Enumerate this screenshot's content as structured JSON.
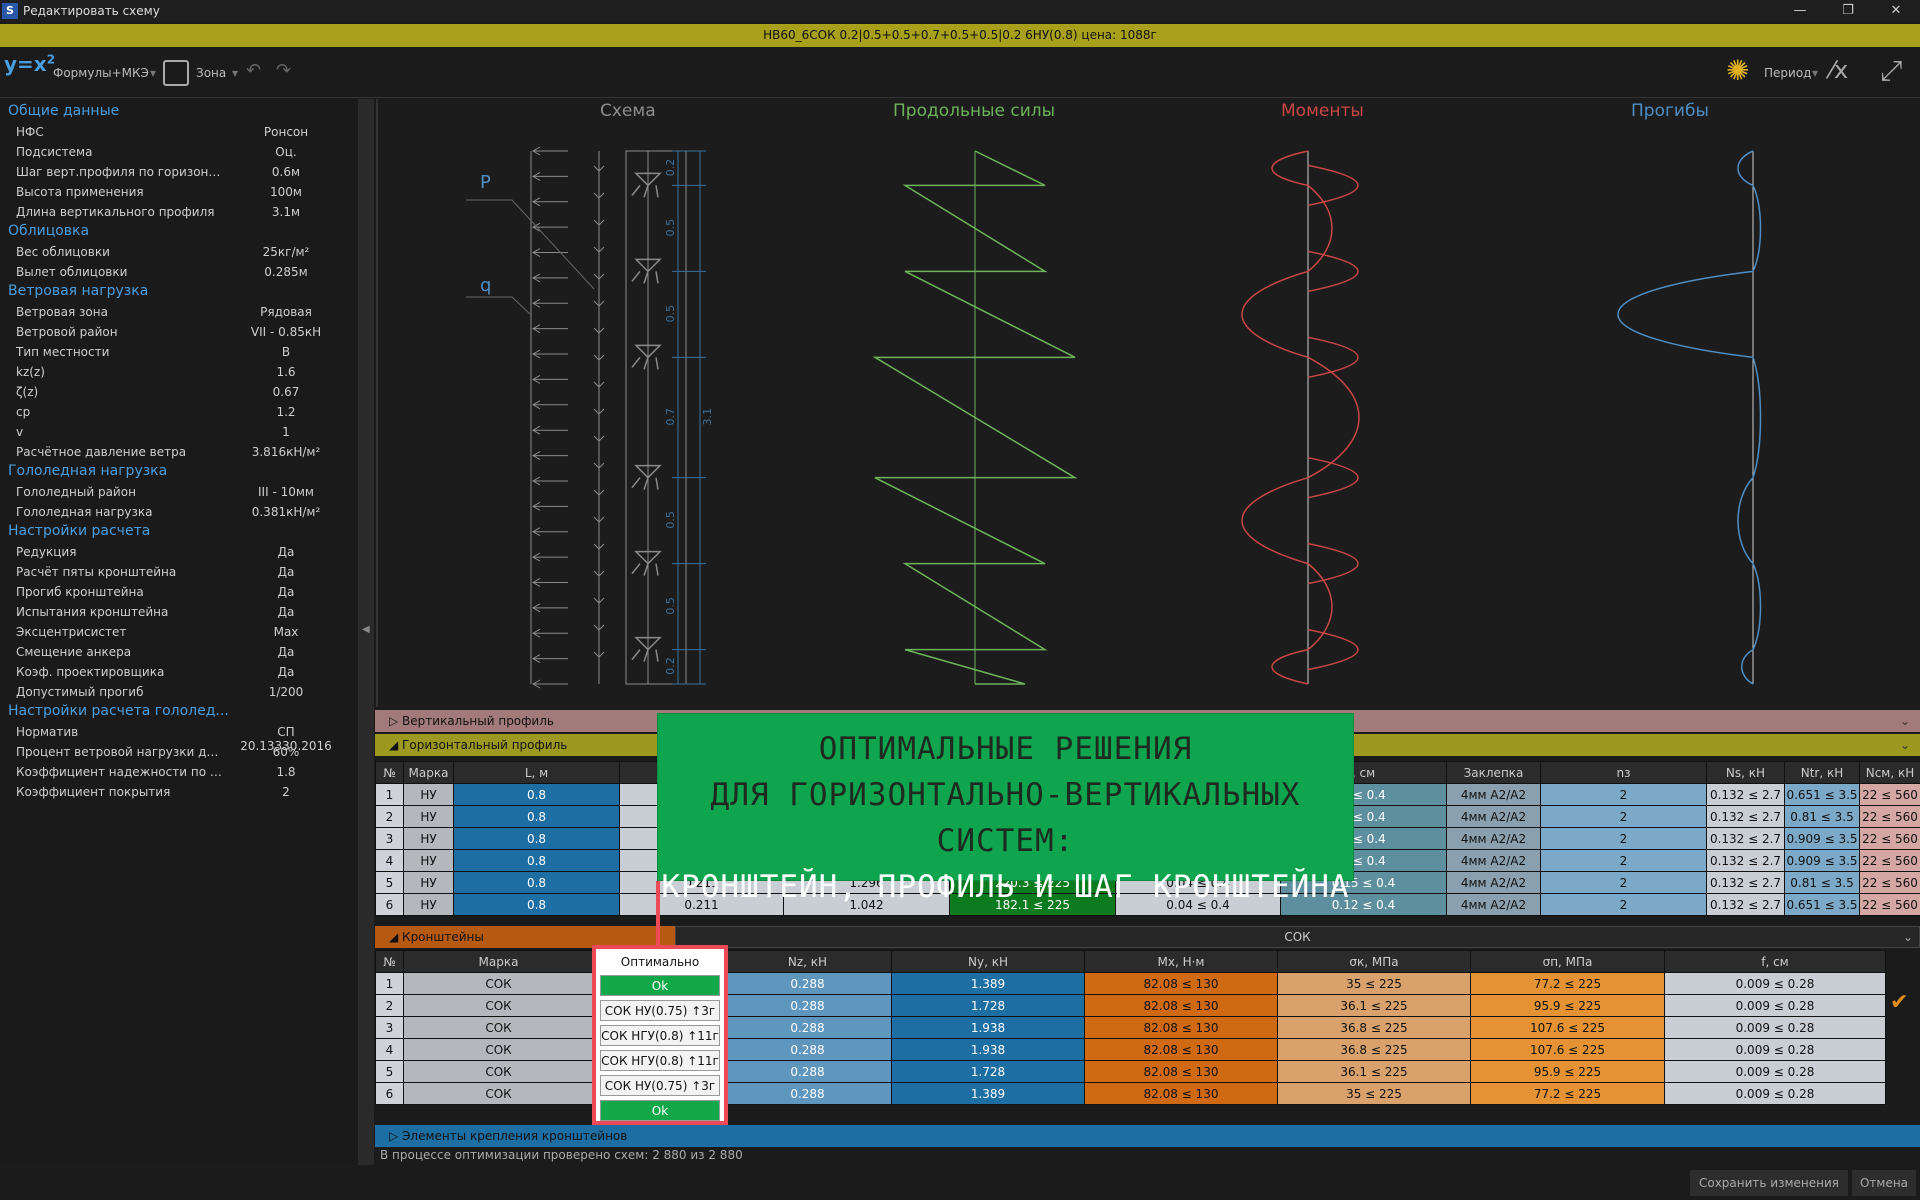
{
  "window": {
    "title": "Редактировать схему",
    "app_icon": "S"
  },
  "infobar": {
    "text": "НВ60_6СОК   0.2|0.5+0.5+0.7+0.5+0.5|0.2   6НУ(0.8)   цена: 1088г"
  },
  "toolbar": {
    "formula_label": "Формулы+МКЭ",
    "zone_label": "Зона",
    "period_label": "Период"
  },
  "left_panel": {
    "groups": [
      {
        "title": "Общие данные",
        "props": [
          [
            "НФС",
            "Ронсон"
          ],
          [
            "Подсистема",
            "Оц."
          ],
          [
            "Шаг верт.профиля по горизонта...",
            "0.6м"
          ],
          [
            "Высота применения",
            "100м"
          ],
          [
            "Длина вертикального профиля",
            "3.1м"
          ]
        ]
      },
      {
        "title": "Облицовка",
        "props": [
          [
            "Вес облицовки",
            "25кг/м²"
          ],
          [
            "Вылет облицовки",
            "0.285м"
          ]
        ]
      },
      {
        "title": "Ветровая нагрузка",
        "props": [
          [
            "Ветровая зона",
            "Рядовая"
          ],
          [
            "Ветровой район",
            "VII - 0.85кН"
          ],
          [
            "Тип местности",
            "B"
          ],
          [
            "kz(z)",
            "1.6"
          ],
          [
            "ζ(z)",
            "0.67"
          ],
          [
            "cp",
            "1.2"
          ],
          [
            "v",
            "1"
          ],
          [
            "Расчётное давление ветра",
            "3.816кН/м²"
          ]
        ]
      },
      {
        "title": "Гололедная нагрузка",
        "props": [
          [
            "Гололедный район",
            "III - 10мм"
          ],
          [
            "Гололедная нагрузка",
            "0.381кН/м²"
          ]
        ]
      },
      {
        "title": "Настройки расчета",
        "props": [
          [
            "Редукция",
            "Да"
          ],
          [
            "Расчёт пяты кронштейна",
            "Да"
          ],
          [
            "Прогиб кронштейна",
            "Да"
          ],
          [
            "Испытания кронштейна",
            "Да"
          ],
          [
            "Эксцентрисистет",
            "Max"
          ],
          [
            "Смещение анкера",
            "Да"
          ],
          [
            "Коэф. проектировщика",
            "Да"
          ],
          [
            "Допустимый прогиб",
            "1/200"
          ]
        ]
      },
      {
        "title": "Настройки расчета гололед...",
        "props": [
          [
            "Норматив",
            "СП 20.13330.2016"
          ],
          [
            "Процент ветровой нагрузки для ...",
            "60%"
          ],
          [
            "Коэффициент надежности по го...",
            "1.8"
          ],
          [
            "Коэффициент покрытия",
            "2"
          ]
        ]
      }
    ]
  },
  "diagrams": {
    "titles": [
      "Схема",
      "Продольные силы",
      "Моменты",
      "Прогибы"
    ],
    "label_p": "P",
    "label_q": "q",
    "dims": [
      "0.2",
      "0.5",
      "0.5",
      "0.7",
      "0.5",
      "0.5",
      "0.2"
    ],
    "total": "3.1",
    "colors": {
      "scheme": "#8a8a8a",
      "forces": "#6db35a",
      "moments": "#c94646",
      "deflection": "#4f8ec4"
    }
  },
  "vertical_profile": {
    "label": "Вертикальный профиль"
  },
  "horizontal_profile": {
    "label": "Горизонтальный профиль",
    "headers_left": [
      "№",
      "Марка",
      "L, м"
    ],
    "headers_right": [
      ", см",
      "Заклепка",
      "nз",
      "Ns, кН",
      "Ntr, кН",
      "Nсм, кН"
    ],
    "rows": [
      {
        "n": "1",
        "m": "НУ",
        "l": "0.8",
        "c1": "",
        "c2": "",
        "c3": "",
        "c4": "",
        "f": "2 ≤ 0.4",
        "z": "4мм A2/A2",
        "nz": "2",
        "ns": "0.132 ≤ 2.7",
        "ntr": "0.651 ≤ 3.5",
        "nsm": "22 ≤ 560"
      },
      {
        "n": "2",
        "m": "НУ",
        "l": "0.8",
        "c1": "",
        "c2": "",
        "c3": "",
        "c4": "",
        "f": "5 ≤ 0.4",
        "z": "4мм A2/A2",
        "nz": "2",
        "ns": "0.132 ≤ 2.7",
        "ntr": "0.81 ≤ 3.5",
        "nsm": "22 ≤ 560"
      },
      {
        "n": "3",
        "m": "НУ",
        "l": "0.8",
        "c1": "",
        "c2": "",
        "c3": "",
        "c4": "",
        "f": "7 ≤ 0.4",
        "z": "4мм A2/A2",
        "nz": "2",
        "ns": "0.132 ≤ 2.7",
        "ntr": "0.909 ≤ 3.5",
        "nsm": "22 ≤ 560"
      },
      {
        "n": "4",
        "m": "НУ",
        "l": "0.8",
        "c1": "",
        "c2": "",
        "c3": "",
        "c4": "",
        "f": "7 ≤ 0.4",
        "z": "4мм A2/A2",
        "nz": "2",
        "ns": "0.132 ≤ 2.7",
        "ntr": "0.909 ≤ 3.5",
        "nsm": "22 ≤ 560"
      },
      {
        "n": "5",
        "m": "НУ",
        "l": "0.8",
        "c1": "0.211",
        "c2": "1.296",
        "c3": "220.3 ≤ 225",
        "c4": "0.04 ≤ 0.4",
        "f": "0.15 ≤ 0.4",
        "z": "4мм A2/A2",
        "nz": "2",
        "ns": "0.132 ≤ 2.7",
        "ntr": "0.81 ≤ 3.5",
        "nsm": "22 ≤ 560"
      },
      {
        "n": "6",
        "m": "НУ",
        "l": "0.8",
        "c1": "0.211",
        "c2": "1.042",
        "c3": "182.1 ≤ 225",
        "c4": "0.04 ≤ 0.4",
        "f": "0.12 ≤ 0.4",
        "z": "4мм A2/A2",
        "nz": "2",
        "ns": "0.132 ≤ 2.7",
        "ntr": "0.651 ≤ 3.5",
        "nsm": "22 ≤ 560"
      }
    ]
  },
  "brackets": {
    "label": "Кронштейны",
    "selected": "СОК",
    "headers": [
      "№",
      "Марка",
      "Оптимально",
      "Nz, кН",
      "Ny, кН",
      "Mx, Н·м",
      "σк, МПа",
      "σп, МПа",
      "f, см"
    ],
    "rows": [
      {
        "n": "1",
        "m": "СОК",
        "opt": "Ok",
        "nz": "0.288",
        "ny": "1.389",
        "mx": "82.08 ≤ 130",
        "sk": "35 ≤ 225",
        "sp": "77.2 ≤ 225",
        "f": "0.009 ≤ 0.28"
      },
      {
        "n": "2",
        "m": "СОК",
        "opt": "СОК НУ(0.75) ↑3г",
        "nz": "0.288",
        "ny": "1.728",
        "mx": "82.08 ≤ 130",
        "sk": "36.1 ≤ 225",
        "sp": "95.9 ≤ 225",
        "f": "0.009 ≤ 0.28"
      },
      {
        "n": "3",
        "m": "СОК",
        "opt": "СОК НГУ(0.8) ↑11г",
        "nz": "0.288",
        "ny": "1.938",
        "mx": "82.08 ≤ 130",
        "sk": "36.8 ≤ 225",
        "sp": "107.6 ≤ 225",
        "f": "0.009 ≤ 0.28"
      },
      {
        "n": "4",
        "m": "СОК",
        "opt": "СОК НГУ(0.8) ↑11г",
        "nz": "0.288",
        "ny": "1.938",
        "mx": "82.08 ≤ 130",
        "sk": "36.8 ≤ 225",
        "sp": "107.6 ≤ 225",
        "f": "0.009 ≤ 0.28"
      },
      {
        "n": "5",
        "m": "СОК",
        "opt": "СОК НУ(0.75) ↑3г",
        "nz": "0.288",
        "ny": "1.728",
        "mx": "82.08 ≤ 130",
        "sk": "36.1 ≤ 225",
        "sp": "95.9 ≤ 225",
        "f": "0.009 ≤ 0.28"
      },
      {
        "n": "6",
        "m": "СОК",
        "opt": "Ok",
        "nz": "0.288",
        "ny": "1.389",
        "mx": "82.08 ≤ 130",
        "sk": "35 ≤ 225",
        "sp": "77.2 ≤ 225",
        "f": "0.009 ≤ 0.28"
      }
    ]
  },
  "fastening": {
    "label": "Элементы крепления кронштейнов"
  },
  "status": {
    "text": "В процессе оптимизации проверено схем: 2 880 из 2 880"
  },
  "overlay": {
    "line1": "ОПТИМАЛЬНЫЕ РЕШЕНИЯ",
    "line2": "ДЛЯ ГОРИЗОНТАЛЬНО-ВЕРТИКАЛЬНЫХ СИСТЕМ:",
    "line3": "КРОНШТЕЙН, ПРОФИЛЬ И ШАГ КРОНШТЕЙНА"
  },
  "buttons": {
    "save": "Сохранить изменения",
    "cancel": "Отмена"
  }
}
